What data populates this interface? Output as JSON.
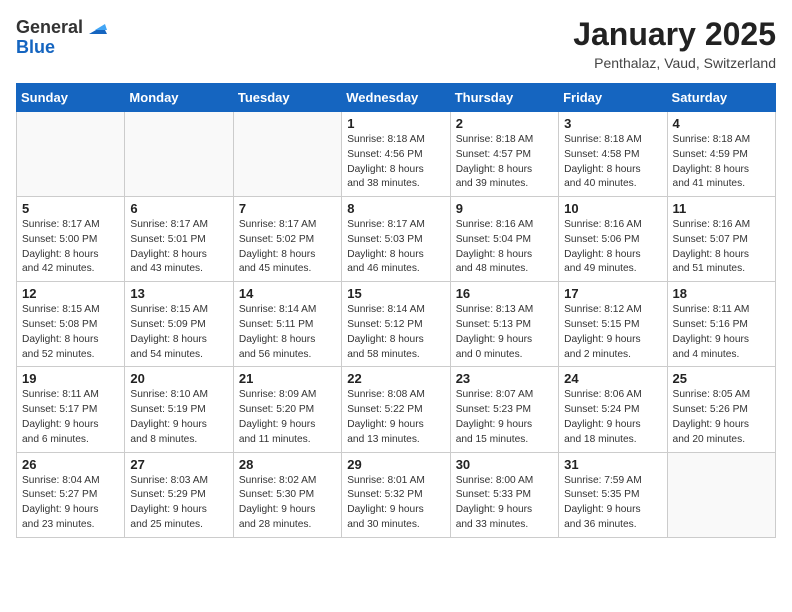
{
  "header": {
    "logo_general": "General",
    "logo_blue": "Blue",
    "title": "January 2025",
    "subtitle": "Penthalaz, Vaud, Switzerland"
  },
  "weekdays": [
    "Sunday",
    "Monday",
    "Tuesday",
    "Wednesday",
    "Thursday",
    "Friday",
    "Saturday"
  ],
  "weeks": [
    [
      {
        "day": "",
        "info": ""
      },
      {
        "day": "",
        "info": ""
      },
      {
        "day": "",
        "info": ""
      },
      {
        "day": "1",
        "info": "Sunrise: 8:18 AM\nSunset: 4:56 PM\nDaylight: 8 hours\nand 38 minutes."
      },
      {
        "day": "2",
        "info": "Sunrise: 8:18 AM\nSunset: 4:57 PM\nDaylight: 8 hours\nand 39 minutes."
      },
      {
        "day": "3",
        "info": "Sunrise: 8:18 AM\nSunset: 4:58 PM\nDaylight: 8 hours\nand 40 minutes."
      },
      {
        "day": "4",
        "info": "Sunrise: 8:18 AM\nSunset: 4:59 PM\nDaylight: 8 hours\nand 41 minutes."
      }
    ],
    [
      {
        "day": "5",
        "info": "Sunrise: 8:17 AM\nSunset: 5:00 PM\nDaylight: 8 hours\nand 42 minutes."
      },
      {
        "day": "6",
        "info": "Sunrise: 8:17 AM\nSunset: 5:01 PM\nDaylight: 8 hours\nand 43 minutes."
      },
      {
        "day": "7",
        "info": "Sunrise: 8:17 AM\nSunset: 5:02 PM\nDaylight: 8 hours\nand 45 minutes."
      },
      {
        "day": "8",
        "info": "Sunrise: 8:17 AM\nSunset: 5:03 PM\nDaylight: 8 hours\nand 46 minutes."
      },
      {
        "day": "9",
        "info": "Sunrise: 8:16 AM\nSunset: 5:04 PM\nDaylight: 8 hours\nand 48 minutes."
      },
      {
        "day": "10",
        "info": "Sunrise: 8:16 AM\nSunset: 5:06 PM\nDaylight: 8 hours\nand 49 minutes."
      },
      {
        "day": "11",
        "info": "Sunrise: 8:16 AM\nSunset: 5:07 PM\nDaylight: 8 hours\nand 51 minutes."
      }
    ],
    [
      {
        "day": "12",
        "info": "Sunrise: 8:15 AM\nSunset: 5:08 PM\nDaylight: 8 hours\nand 52 minutes."
      },
      {
        "day": "13",
        "info": "Sunrise: 8:15 AM\nSunset: 5:09 PM\nDaylight: 8 hours\nand 54 minutes."
      },
      {
        "day": "14",
        "info": "Sunrise: 8:14 AM\nSunset: 5:11 PM\nDaylight: 8 hours\nand 56 minutes."
      },
      {
        "day": "15",
        "info": "Sunrise: 8:14 AM\nSunset: 5:12 PM\nDaylight: 8 hours\nand 58 minutes."
      },
      {
        "day": "16",
        "info": "Sunrise: 8:13 AM\nSunset: 5:13 PM\nDaylight: 9 hours\nand 0 minutes."
      },
      {
        "day": "17",
        "info": "Sunrise: 8:12 AM\nSunset: 5:15 PM\nDaylight: 9 hours\nand 2 minutes."
      },
      {
        "day": "18",
        "info": "Sunrise: 8:11 AM\nSunset: 5:16 PM\nDaylight: 9 hours\nand 4 minutes."
      }
    ],
    [
      {
        "day": "19",
        "info": "Sunrise: 8:11 AM\nSunset: 5:17 PM\nDaylight: 9 hours\nand 6 minutes."
      },
      {
        "day": "20",
        "info": "Sunrise: 8:10 AM\nSunset: 5:19 PM\nDaylight: 9 hours\nand 8 minutes."
      },
      {
        "day": "21",
        "info": "Sunrise: 8:09 AM\nSunset: 5:20 PM\nDaylight: 9 hours\nand 11 minutes."
      },
      {
        "day": "22",
        "info": "Sunrise: 8:08 AM\nSunset: 5:22 PM\nDaylight: 9 hours\nand 13 minutes."
      },
      {
        "day": "23",
        "info": "Sunrise: 8:07 AM\nSunset: 5:23 PM\nDaylight: 9 hours\nand 15 minutes."
      },
      {
        "day": "24",
        "info": "Sunrise: 8:06 AM\nSunset: 5:24 PM\nDaylight: 9 hours\nand 18 minutes."
      },
      {
        "day": "25",
        "info": "Sunrise: 8:05 AM\nSunset: 5:26 PM\nDaylight: 9 hours\nand 20 minutes."
      }
    ],
    [
      {
        "day": "26",
        "info": "Sunrise: 8:04 AM\nSunset: 5:27 PM\nDaylight: 9 hours\nand 23 minutes."
      },
      {
        "day": "27",
        "info": "Sunrise: 8:03 AM\nSunset: 5:29 PM\nDaylight: 9 hours\nand 25 minutes."
      },
      {
        "day": "28",
        "info": "Sunrise: 8:02 AM\nSunset: 5:30 PM\nDaylight: 9 hours\nand 28 minutes."
      },
      {
        "day": "29",
        "info": "Sunrise: 8:01 AM\nSunset: 5:32 PM\nDaylight: 9 hours\nand 30 minutes."
      },
      {
        "day": "30",
        "info": "Sunrise: 8:00 AM\nSunset: 5:33 PM\nDaylight: 9 hours\nand 33 minutes."
      },
      {
        "day": "31",
        "info": "Sunrise: 7:59 AM\nSunset: 5:35 PM\nDaylight: 9 hours\nand 36 minutes."
      },
      {
        "day": "",
        "info": ""
      }
    ]
  ]
}
